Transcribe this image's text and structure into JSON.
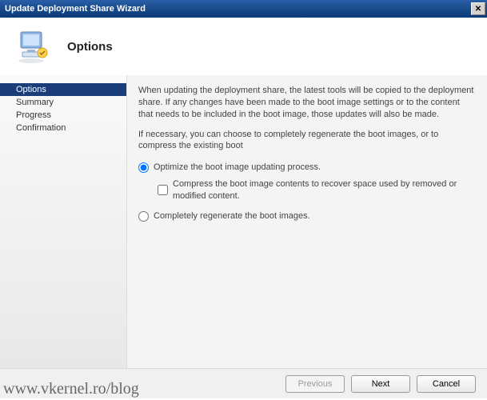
{
  "window": {
    "title": "Update Deployment Share Wizard",
    "close_glyph": "✕"
  },
  "header": {
    "title": "Options"
  },
  "sidebar": {
    "items": [
      {
        "label": "Options",
        "selected": true
      },
      {
        "label": "Summary",
        "selected": false
      },
      {
        "label": "Progress",
        "selected": false
      },
      {
        "label": "Confirmation",
        "selected": false
      }
    ]
  },
  "content": {
    "desc1": "When updating the deployment share, the latest tools will be copied to the deployment share.  If any changes have been made to the boot image settings or to the content that needs to be included in the boot image, those updates will also be made.",
    "desc2": "If necessary, you can choose to completely regenerate the boot images, or to compress the existing boot",
    "opt_optimize": "Optimize the boot image updating process.",
    "opt_compress": "Compress the boot image contents to recover space used by removed or modified content.",
    "opt_regenerate": "Completely regenerate the boot images."
  },
  "footer": {
    "previous": "Previous",
    "next": "Next",
    "cancel": "Cancel"
  },
  "watermark": "www.vkernel.ro/blog"
}
